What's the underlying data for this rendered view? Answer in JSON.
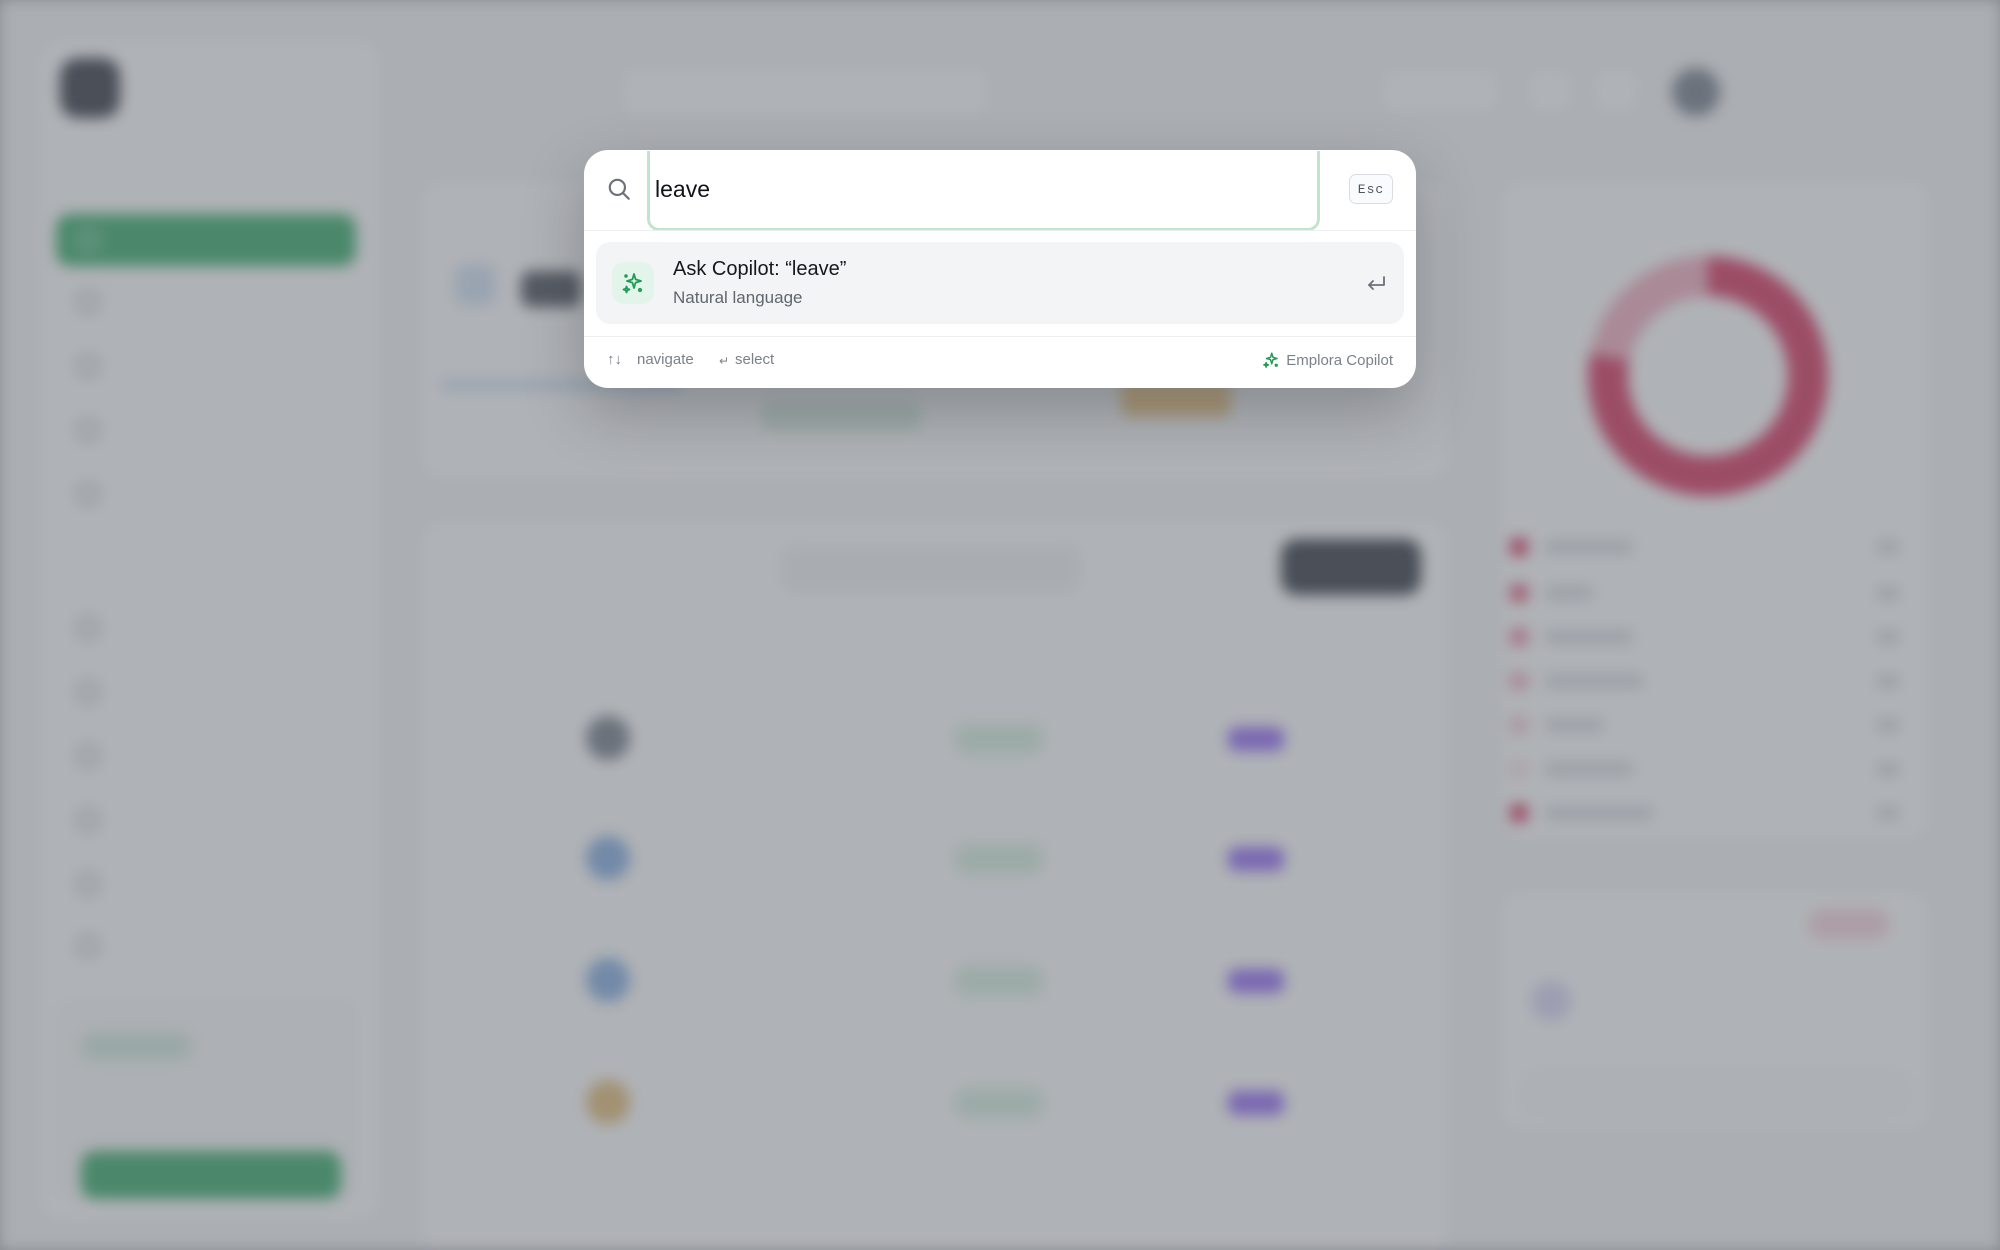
{
  "palette": {
    "search_value": "leave",
    "esc_label": "Esc",
    "results": [
      {
        "title": "Ask Copilot: “leave”",
        "subtitle": "Natural language",
        "icon": "sparkle-icon"
      }
    ],
    "footer": {
      "navigate_glyph": "↑↓",
      "navigate_label": "navigate",
      "select_glyph": "↵",
      "select_label": "select",
      "brand_label": "Emplora Copilot"
    }
  },
  "colors": {
    "accent_green": "#22a35a",
    "copilot_green": "#1f9d55",
    "focus_ring": "#bfe5cf"
  }
}
